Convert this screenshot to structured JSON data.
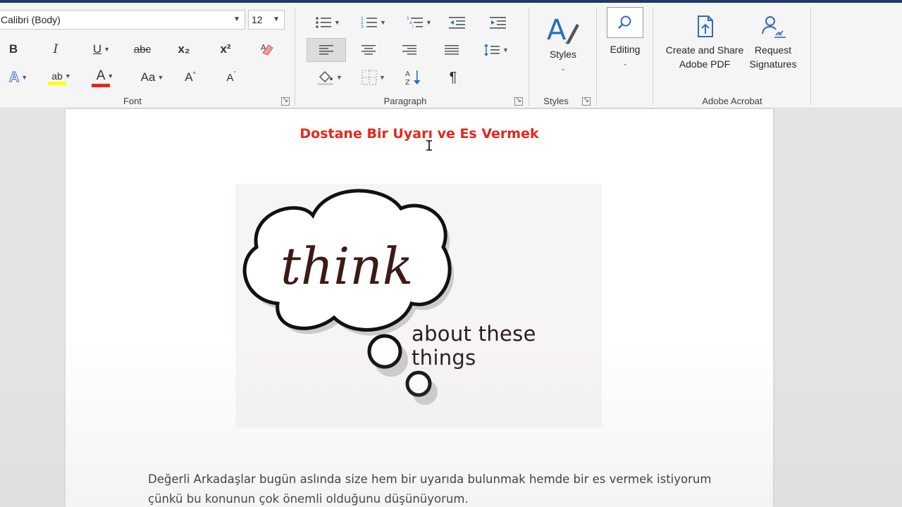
{
  "ribbon": {
    "font": {
      "family_value": "Calibri (Body)",
      "size_value": "12",
      "bold_label": "B",
      "italic_label": "I",
      "underline_label": "U",
      "strike_label": "abc",
      "subscript_label": "x₂",
      "superscript_label": "x²",
      "effects_label": "A",
      "highlight_label": "ab",
      "fontcolor_label": "A",
      "case_label": "Aa",
      "grow_label": "A",
      "shrink_label": "A",
      "group_label": "Font"
    },
    "paragraph": {
      "group_label": "Paragraph"
    },
    "styles": {
      "button_label": "Styles",
      "group_label": "Styles"
    },
    "editing": {
      "button_label": "Editing"
    },
    "acrobat": {
      "create_label_1": "Create and Share",
      "create_label_2": "Adobe PDF",
      "request_label_1": "Request",
      "request_label_2": "Signatures",
      "group_label": "Adobe Acrobat"
    },
    "colors": {
      "highlight": "#ffff00",
      "font_color": "#e3281b",
      "acrobat_blue": "#2b6cc4"
    }
  },
  "document": {
    "title": "Dostane Bir Uyarı ve Es Vermek",
    "title_color": "#e3281b",
    "image": {
      "bubble_word": "think",
      "caption": "about these things"
    },
    "body_line_1": "Değerli Arkadaşlar bugün aslında size hem bir uyarıda bulunmak hemde bir es vermek istiyorum",
    "body_line_2": "çünkü bu konunun çok önemli olduğunu düşünüyorum."
  }
}
